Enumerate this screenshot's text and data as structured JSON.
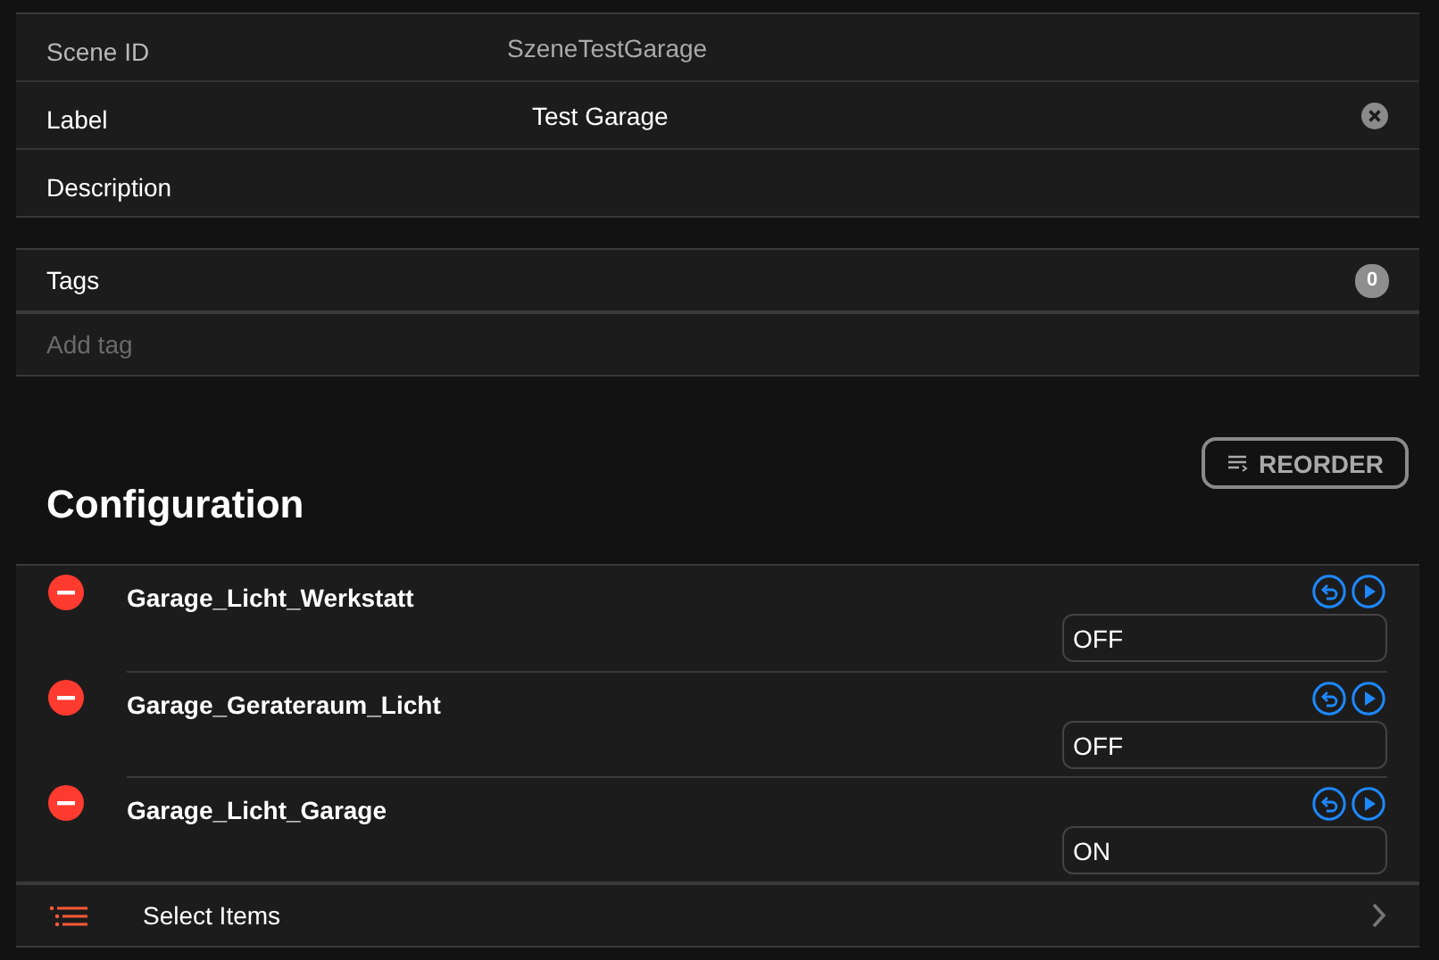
{
  "fields": [
    {
      "kind": "readonly",
      "label": "Scene ID",
      "value": "SzeneTestGarage"
    },
    {
      "kind": "input",
      "label": "Label",
      "value": "Test Garage",
      "clearable": true
    },
    {
      "kind": "input",
      "label": "Description"
    }
  ],
  "tags": {
    "title": "Tags",
    "count": "0",
    "placeholder": "Add tag"
  },
  "configuration": {
    "title": "Configuration",
    "reorder_button": "REORDER",
    "items": [
      {
        "name": "Garage_Licht_Werkstatt",
        "state": "OFF"
      },
      {
        "name": "Garage_Gerateraum_Licht",
        "state": "OFF"
      },
      {
        "name": "Garage_Licht_Garage",
        "state": "ON"
      }
    ],
    "select_items": "Select Items"
  }
}
